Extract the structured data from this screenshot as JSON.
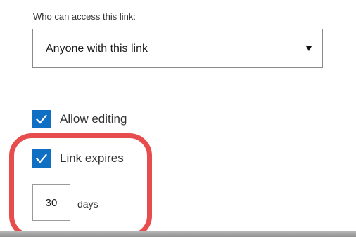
{
  "access": {
    "label": "Who can access this link:",
    "selected_option": "Anyone with this link"
  },
  "options": {
    "allow_editing": {
      "label": "Allow editing",
      "checked": true
    },
    "link_expires": {
      "label": "Link expires",
      "checked": true
    }
  },
  "expiry": {
    "value": "30",
    "unit_label": "days"
  },
  "icons": {
    "dropdown": "dropdown-arrow-icon",
    "check": "checkmark-icon"
  },
  "colors": {
    "checkbox_fill": "#0e6fc3",
    "highlight": "#e84d4d"
  }
}
